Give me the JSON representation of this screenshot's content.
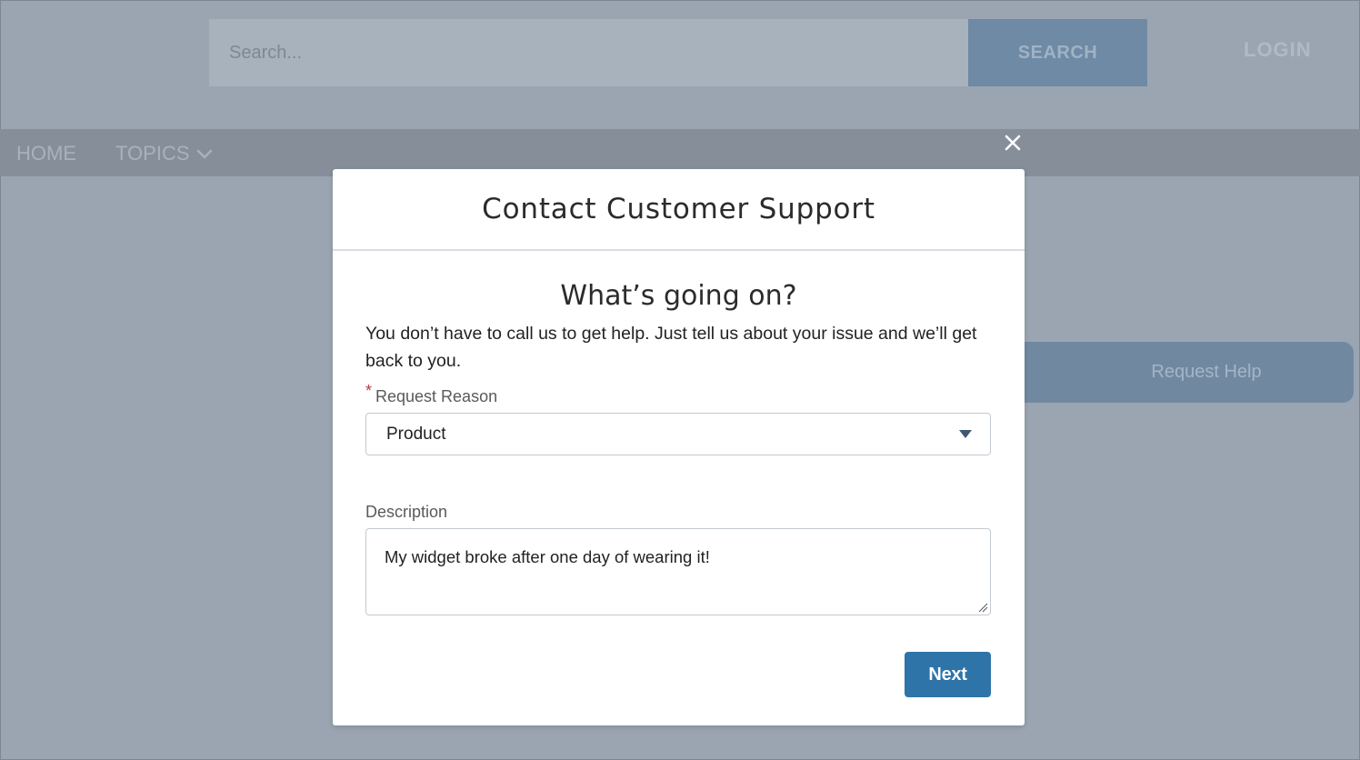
{
  "header": {
    "search_placeholder": "Search...",
    "search_button": "SEARCH",
    "login": "LOGIN"
  },
  "nav": {
    "home": "HOME",
    "topics": "TOPICS"
  },
  "background": {
    "request_help": "Request Help"
  },
  "modal": {
    "title": "Contact Customer Support",
    "heading": "What’s going on?",
    "intro": "You don’t have to call us to get help. Just tell us about your issue and we’ll get back to you.",
    "reason_label": "Request Reason",
    "required_marker": "*",
    "reason_value": "Product",
    "description_label": "Description",
    "description_value": "My widget broke after one day of wearing it!",
    "next_button": "Next"
  },
  "colors": {
    "primary": "#2e74a8",
    "required": "#c23934",
    "overlay": "#9aa5b1"
  }
}
